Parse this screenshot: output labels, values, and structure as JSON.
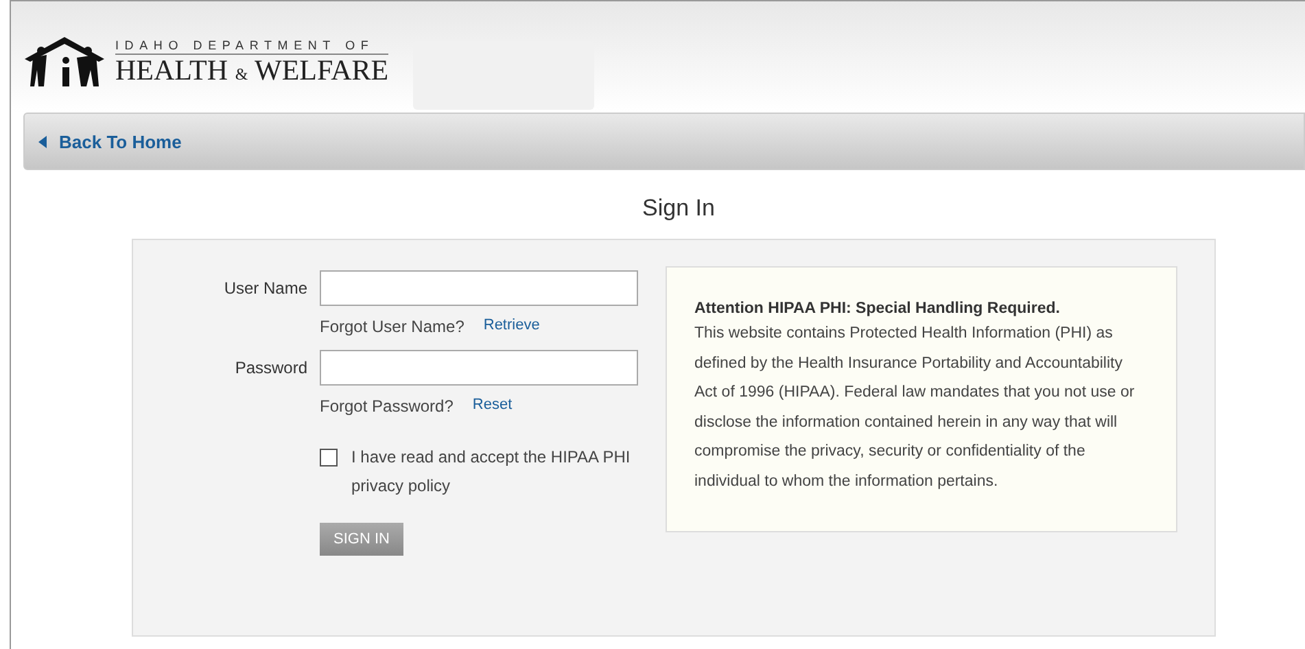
{
  "header": {
    "logo_top": "IDAHO DEPARTMENT OF",
    "logo_main": "HEALTH",
    "logo_amp": "&",
    "logo_end": "WELFARE"
  },
  "nav": {
    "back_link": "Back To Home"
  },
  "title": "Sign In",
  "form": {
    "fields": [
      {
        "label": "User Name",
        "forgot": "Forgot User Name?",
        "link": "Retrieve"
      },
      {
        "label": "Password",
        "forgot": "Forgot Password?",
        "link": "Reset"
      }
    ],
    "agree": {
      "label": "I have read and accept the HIPAA PHI privacy policy",
      "checked": false
    },
    "submit": "SIGN IN"
  },
  "notice": {
    "title": "Attention HIPAA PHI: Special Handling Required.",
    "body": "This website contains Protected Health Information (PHI) as defined by the Health Insurance Portability and Accountability Act of 1996 (HIPAA). Federal law mandates that you not use or disclose the information contained herein in any way that will compromise the privacy, security or confidentiality of the individual to whom the information pertains."
  }
}
